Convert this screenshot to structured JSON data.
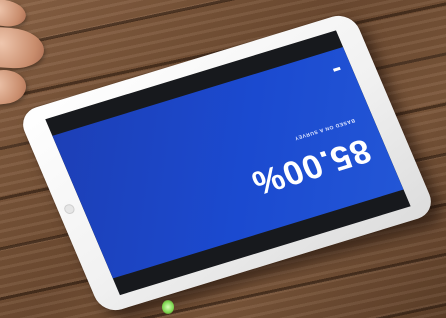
{
  "tablet_slide": {
    "big_value": "85.00%",
    "label": "BASED ON A SURVEY",
    "subtitle": "",
    "caption": "",
    "page_number": ""
  },
  "colors": {
    "slide_background": "#1d45c8",
    "slide_text": "#ffffff",
    "tablet_frame": "#f4f4f4",
    "table_wood": "#7a563a"
  }
}
